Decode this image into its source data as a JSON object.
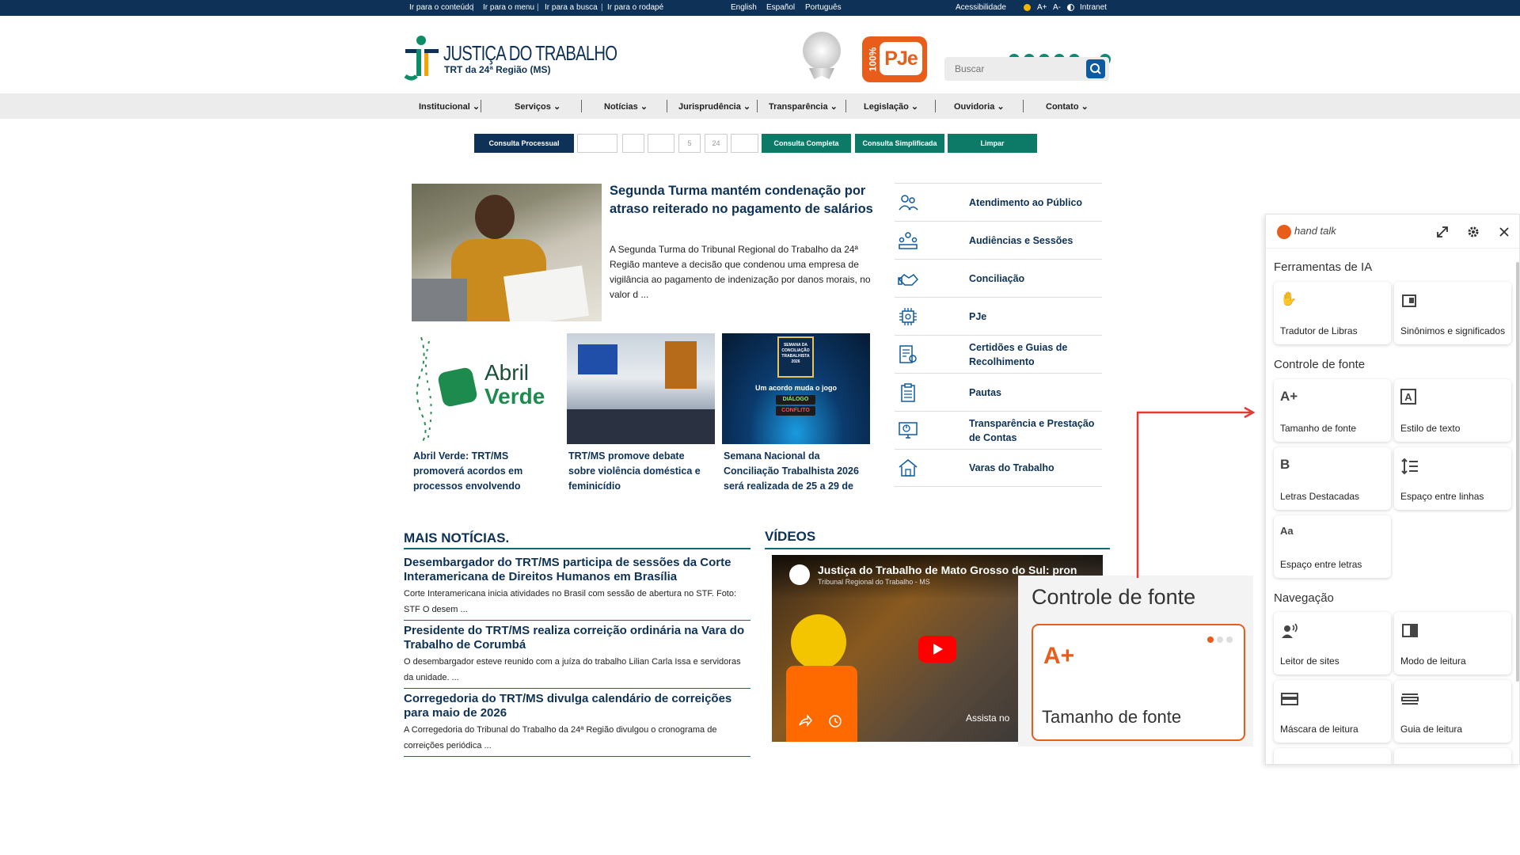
{
  "topbar": {
    "skip_links": [
      "Ir para o conteúdo",
      "Ir para o menu",
      "Ir para a busca",
      "Ir para o rodapé"
    ],
    "languages": [
      "English",
      "Español",
      "Português"
    ],
    "accessibility": "Acessibilidade",
    "font_up": "A+",
    "font_down": "A-",
    "intranet": "Intranet"
  },
  "header": {
    "logo_title": "JUSTIÇA DO TRABALHO",
    "logo_subtitle": "TRT da 24ª Região (MS)",
    "pje_badge": "100%",
    "pje_text": "PJe",
    "search_placeholder": "Buscar"
  },
  "nav": {
    "items": [
      "Institucional",
      "Serviços",
      "Notícias",
      "Jurisprudência",
      "Transparência",
      "Legislação",
      "Ouvidoria",
      "Contato"
    ]
  },
  "consulta": {
    "processual": "Consulta Processual",
    "field_5": "5",
    "field_24": "24",
    "completa": "Consulta Completa",
    "simplificada": "Consulta Simplificada",
    "limpar": "Limpar"
  },
  "featured": {
    "title": "Segunda Turma mantém condenação por atraso reiterado no pagamento de salários",
    "summary": "A Segunda Turma do Tribunal Regional do Trabalho da 24ª Região manteve a decisão que condenou uma empresa de vigilância ao pagamento de indenização por danos morais, no valor d ..."
  },
  "news_cards": [
    {
      "title": "Abril Verde: TRT/MS promoverá acordos em processos envolvendo",
      "image_text_1": "Abril",
      "image_text_2": "Verde"
    },
    {
      "title": "TRT/MS promove debate sobre violência doméstica e feminicídio"
    },
    {
      "title": "Semana Nacional da Conciliação Trabalhista 2026 será realizada de 25 a 29 de",
      "image_lines": [
        "SEMANA DA",
        "CONCILIAÇÃO",
        "TRABALHISTA",
        "2026"
      ],
      "image_tagline": "Um acordo muda o jogo",
      "image_badge_1": "DIÁLOGO",
      "image_badge_2": "CONFLITO"
    }
  ],
  "services": [
    {
      "label": "Atendimento ao Público",
      "icon": "people-icon"
    },
    {
      "label": "Audiências e Sessões",
      "icon": "audience-icon"
    },
    {
      "label": "Conciliação",
      "icon": "handshake-icon"
    },
    {
      "label": "PJe",
      "icon": "chip-icon"
    },
    {
      "label": "Certidões e Guias de Recolhimento",
      "icon": "certificate-icon"
    },
    {
      "label": "Pautas",
      "icon": "clipboard-icon"
    },
    {
      "label": "Transparência e Prestação de Contas",
      "icon": "monitor-chart-icon"
    },
    {
      "label": "Varas do Trabalho",
      "icon": "building-icon"
    }
  ],
  "mais_noticias": {
    "heading": "MAIS NOTÍCIAS.",
    "items": [
      {
        "title": "Desembargador do TRT/MS participa de sessões da Corte Interamericana de Direitos Humanos em Brasília",
        "desc": "Corte Interamericana inicia atividades no Brasil com sessão de abertura no STF. Foto: STF O desem ..."
      },
      {
        "title": "Presidente do TRT/MS realiza correição ordinária na Vara do Trabalho de Corumbá",
        "desc": "O desembargador esteve reunido com a juíza do trabalho Lilian Carla Issa e servidoras da unidade. ..."
      },
      {
        "title": "Corregedoria do TRT/MS divulga calendário de correições para maio de 2026",
        "desc": "A Corregedoria do Tribunal do Trabalho da 24ª Região divulgou o cronograma de correições periódica ..."
      }
    ]
  },
  "videos": {
    "heading": "VÍDEOS",
    "video_title": "Justiça do Trabalho de Mato Grosso do Sul: pron",
    "channel": "Tribunal Regional do Trabalho - MS",
    "watch_on": "Assista no"
  },
  "zoom_callout": {
    "title": "Controle de fonte",
    "tile_icon": "A+",
    "tile_label": "Tamanho de fonte",
    "accent": "#e85d1a"
  },
  "handtalk": {
    "brand": "hand talk",
    "sections": [
      {
        "title": "Ferramentas de IA",
        "tiles": [
          {
            "label": "Tradutor de Libras",
            "icon": "sign-hands-icon"
          },
          {
            "label": "Sinônimos e significados",
            "icon": "book-icon"
          }
        ]
      },
      {
        "title": "Controle de fonte",
        "tiles": [
          {
            "label": "Tamanho de fonte",
            "icon": "A+"
          },
          {
            "label": "Estilo de texto",
            "icon": "A"
          },
          {
            "label": "Letras Destacadas",
            "icon": "B"
          },
          {
            "label": "Espaço entre linhas",
            "icon": "line-spacing-icon"
          },
          {
            "label": "Espaço entre letras",
            "icon": "Aa"
          }
        ]
      },
      {
        "title": "Navegação",
        "tiles": [
          {
            "label": "Leitor de sites",
            "icon": "speaker-person-icon"
          },
          {
            "label": "Modo de leitura",
            "icon": "reading-mode-icon"
          },
          {
            "label": "Máscara de leitura",
            "icon": "mask-icon"
          },
          {
            "label": "Guia de leitura",
            "icon": "guide-icon"
          }
        ]
      }
    ]
  },
  "colors": {
    "navy": "#0d3157",
    "teal": "#0d7a68",
    "arrow": "#e53935"
  }
}
